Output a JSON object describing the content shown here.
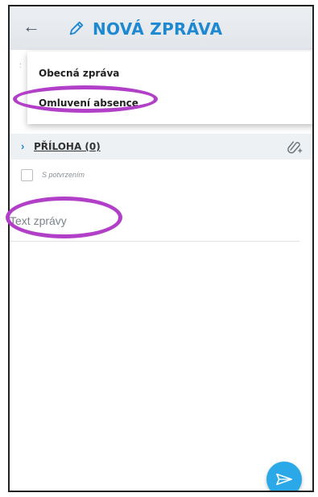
{
  "header": {
    "back_icon": "arrow-left-icon",
    "title_icon": "pencil-icon",
    "title": "NOVÁ ZPRÁVA",
    "title_color": "#1e88d0"
  },
  "message_type_menu": {
    "items": [
      {
        "label": "Obecná zpráva"
      },
      {
        "label": "Omluvení absence"
      }
    ]
  },
  "attachments": {
    "label": "PŘÍLOHA (0)",
    "chevron_icon": "chevron-right-icon",
    "add_icon": "paperclip-plus-icon"
  },
  "confirmation": {
    "label": "S potvrzením",
    "checked": false
  },
  "message": {
    "placeholder": "Text zprávy"
  },
  "send": {
    "icon": "send-paper-plane-icon",
    "color": "#2aa8e8"
  },
  "annotations": {
    "highlight_color": "#b23fc7"
  }
}
